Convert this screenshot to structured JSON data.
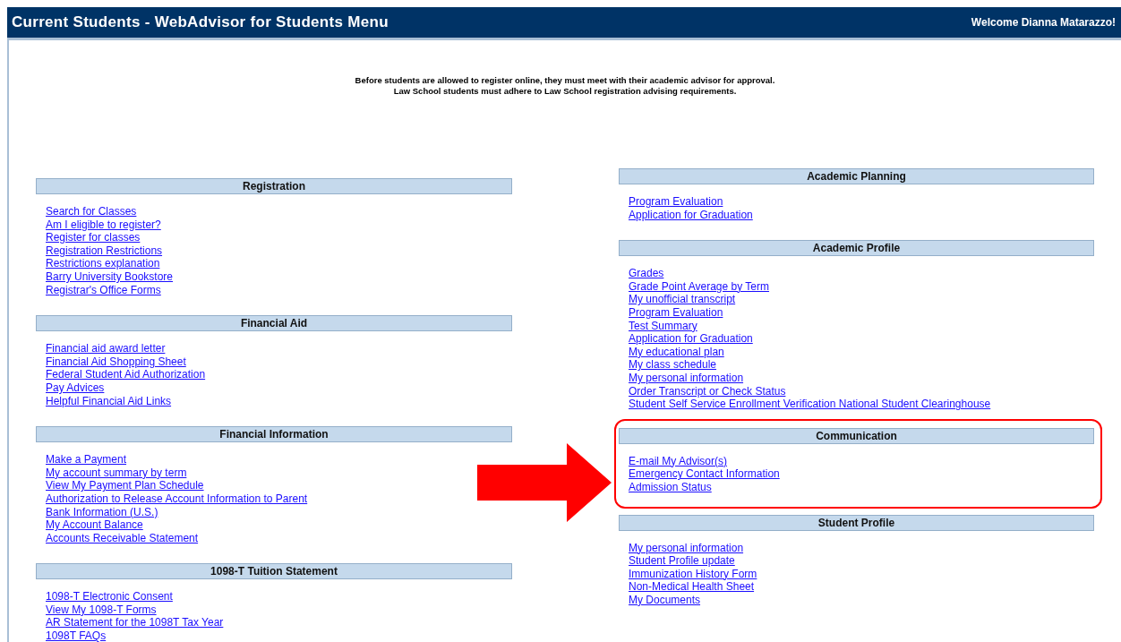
{
  "header": {
    "title": "Current Students - WebAdvisor for Students Menu",
    "welcome": "Welcome Dianna Matarazzo!"
  },
  "notice": [
    "Before students are allowed to register online, they must meet with their academic advisor for approval.",
    "Law School students must adhere to Law School registration advising requirements."
  ],
  "left_column": [
    {
      "title": "Registration",
      "highlighted": false,
      "links": [
        "Search for Classes",
        "Am I eligible to register?",
        "Register for classes",
        "Registration Restrictions",
        "Restrictions explanation",
        "Barry University Bookstore",
        "Registrar's Office Forms"
      ]
    },
    {
      "title": "Financial Aid",
      "highlighted": false,
      "links": [
        "Financial aid award letter",
        "Financial Aid Shopping Sheet",
        "Federal Student Aid Authorization",
        "Pay Advices",
        "Helpful Financial Aid Links"
      ]
    },
    {
      "title": "Financial Information",
      "highlighted": false,
      "links": [
        "Make a Payment",
        "My account summary by term",
        "View My Payment Plan Schedule",
        "Authorization to Release Account Information to Parent",
        "Bank Information (U.S.)",
        "My Account Balance",
        "Accounts Receivable Statement"
      ]
    },
    {
      "title": "1098-T Tuition Statement",
      "highlighted": false,
      "links": [
        "1098-T Electronic Consent",
        "View My 1098-T Forms",
        "AR Statement for the 1098T Tax Year",
        "1098T FAQs"
      ]
    }
  ],
  "right_column": [
    {
      "title": "Academic Planning",
      "highlighted": false,
      "links": [
        "Program Evaluation",
        "Application for Graduation"
      ]
    },
    {
      "title": "Academic Profile",
      "highlighted": false,
      "links": [
        "Grades",
        "Grade Point Average by Term",
        "My unofficial transcript",
        "Program Evaluation",
        "Test Summary",
        "Application for Graduation",
        "My educational plan",
        "My class schedule",
        "My personal information",
        "Order Transcript or Check Status",
        "Student Self Service Enrollment Verification National Student Clearinghouse"
      ]
    },
    {
      "title": "Communication",
      "highlighted": true,
      "links": [
        "E-mail My Advisor(s)",
        "Emergency Contact Information",
        "Admission Status"
      ]
    },
    {
      "title": "Student Profile",
      "highlighted": false,
      "links": [
        "My personal information",
        "Student Profile update",
        "Immunization History Form",
        "Non-Medical Health Sheet",
        "My Documents"
      ]
    }
  ]
}
